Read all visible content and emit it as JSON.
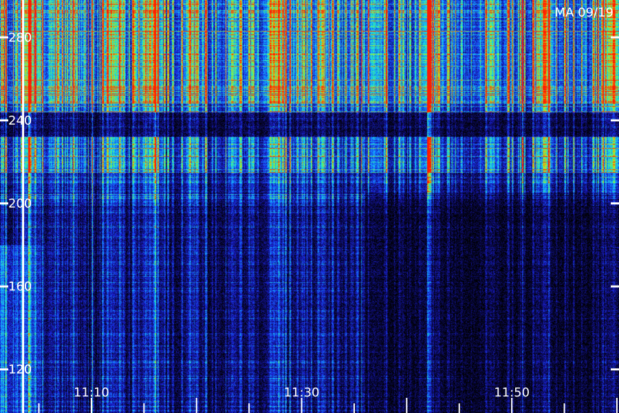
{
  "chart_data": {
    "type": "heatmap",
    "title": "",
    "stamp": "MA 09/19",
    "xlabel": "",
    "ylabel": "",
    "x_ticks": [
      {
        "value": "11:10",
        "minute": 10
      },
      {
        "value": "11:30",
        "minute": 30
      },
      {
        "value": "11:50",
        "minute": 50
      }
    ],
    "y_ticks": [
      120,
      160,
      200,
      240,
      280
    ],
    "xlim_minutes": [
      1.3,
      60.2
    ],
    "ylim": [
      99,
      298
    ],
    "grid": false,
    "colormap": [
      "#000000",
      "#0b0a55",
      "#1a1fd6",
      "#1477ff",
      "#18d6f0",
      "#3cf58a",
      "#c9e415",
      "#ff7a00",
      "#ff1a00"
    ],
    "marker_minute": 3.5,
    "bright_bands": [
      {
        "minute": 4.0,
        "intensity": 0.95
      },
      {
        "minute": 6.5,
        "intensity": 0.55
      },
      {
        "minute": 12.0,
        "intensity": 0.8
      },
      {
        "minute": 15.5,
        "intensity": 0.95
      },
      {
        "minute": 19.5,
        "intensity": 0.6
      },
      {
        "minute": 23.5,
        "intensity": 0.55
      },
      {
        "minute": 27.5,
        "intensity": 0.85
      },
      {
        "minute": 32.0,
        "intensity": 0.5
      },
      {
        "minute": 37.0,
        "intensity": 0.5
      },
      {
        "minute": 42.0,
        "intensity": 0.55
      },
      {
        "minute": 48.0,
        "intensity": 0.5
      },
      {
        "minute": 53.0,
        "intensity": 0.75
      },
      {
        "minute": 59.5,
        "intensity": 0.9
      }
    ],
    "quiet_band": [
      232,
      244
    ]
  }
}
